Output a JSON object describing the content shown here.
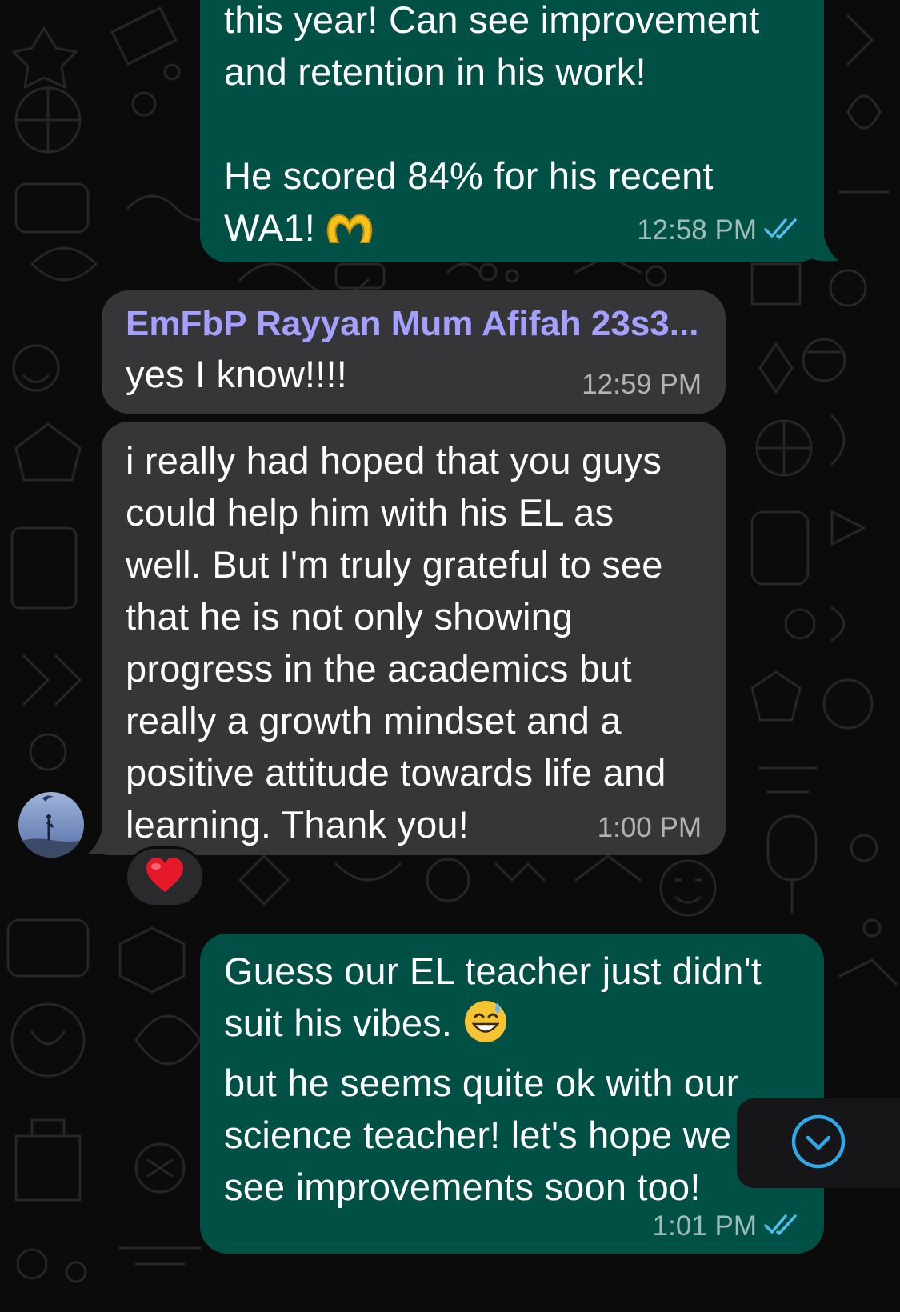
{
  "theme": {
    "background": "#0b0b0b",
    "outgoing_bubble": "#005045",
    "incoming_bubble": "#363638",
    "sender_name_color": "#a4a0ff",
    "read_tick_color": "#53bdeb"
  },
  "messages": [
    {
      "direction": "outgoing",
      "text": "this year! Can see improvement\nand retention in his work!\n\nHe scored 84% for his recent\nWA1! ",
      "emoji": "heart-hands",
      "time": "12:58 PM",
      "status": "read"
    },
    {
      "direction": "incoming",
      "sender": "EmFbP Rayyan Mum Afifah 23s3...",
      "text": "yes I know!!!!",
      "time": "12:59 PM"
    },
    {
      "direction": "incoming",
      "text": "i really had hoped that you guys\ncould help him with his EL as\nwell. But I'm truly grateful to see\nthat he is not only showing\nprogress in the academics but\nreally a growth mindset and a\npositive attitude towards life and\nlearning. Thank you!",
      "time": "1:00 PM",
      "reaction": "❤️"
    },
    {
      "direction": "outgoing",
      "text_line1": "Guess our EL teacher just didn't\nsuit his vibes. ",
      "emoji": "grinning-sweat",
      "text_rest": "but he seems quite ok with our\nscience teacher! let's hope we\nsee improvements soon too!",
      "time": "1:01 PM",
      "status": "read"
    }
  ],
  "scroll_button": {
    "icon": "chevron-down-circle-icon"
  }
}
